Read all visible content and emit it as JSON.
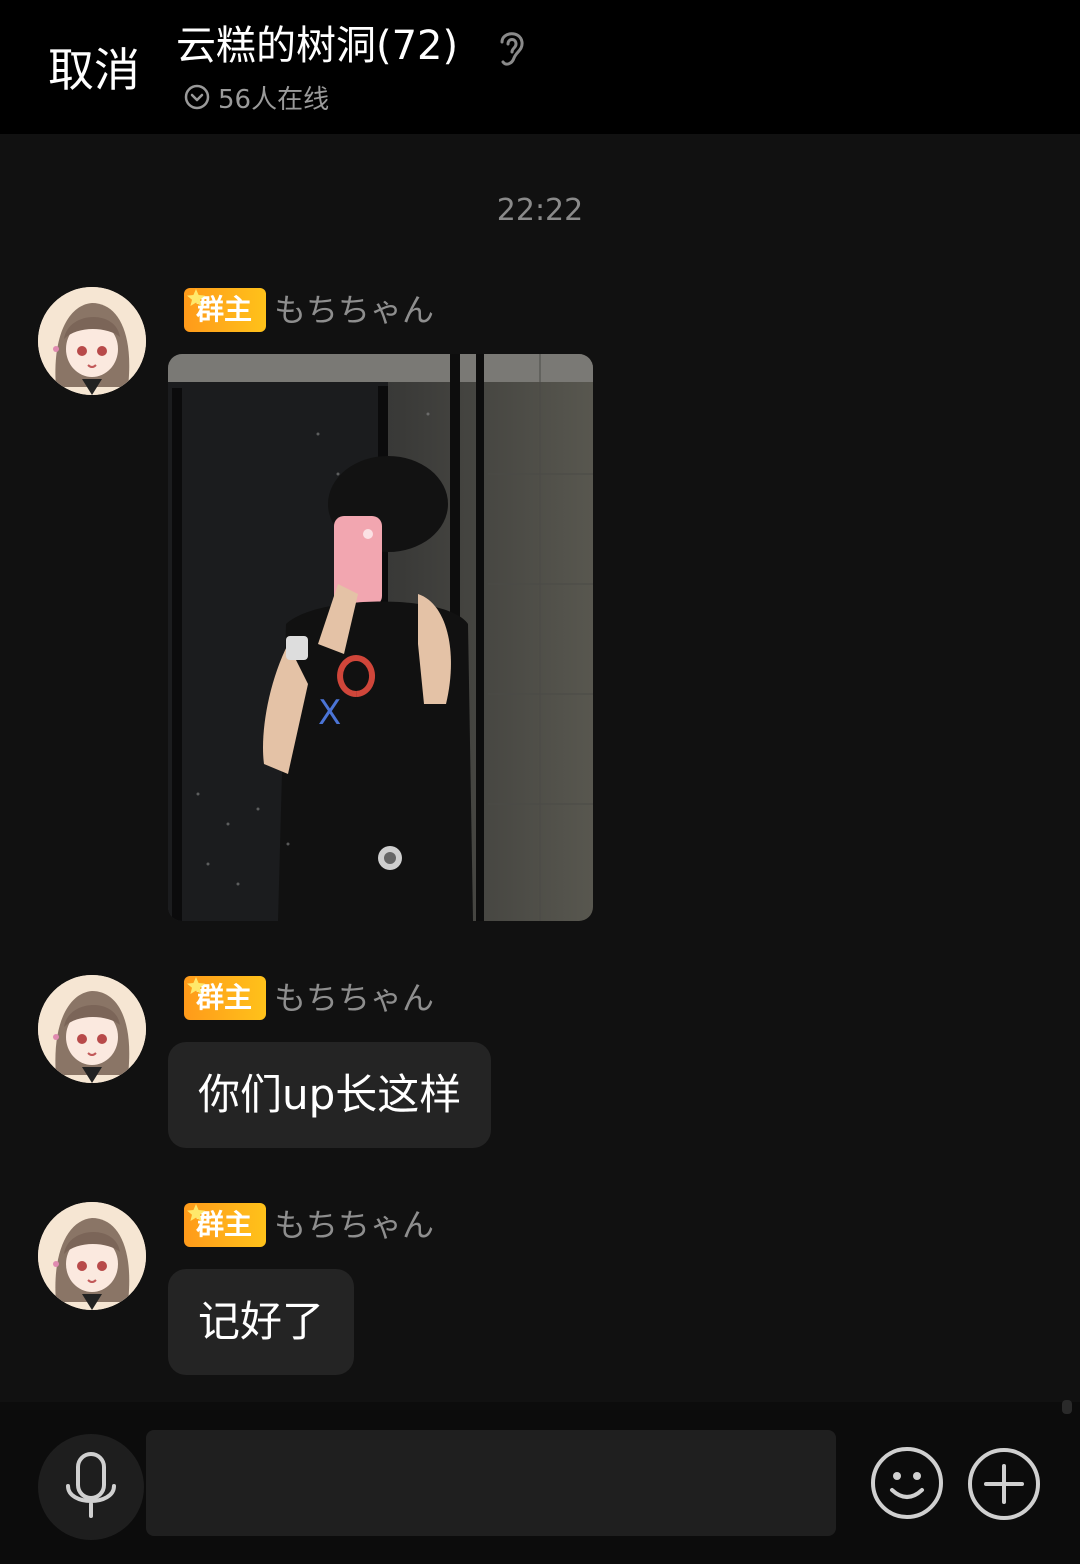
{
  "header": {
    "cancel_label": "取消",
    "title": "云糕的树洞(72)",
    "online": "56人在线"
  },
  "chat": {
    "timestamp": "22:22",
    "messages": [
      {
        "badge": "群主",
        "sender": "もちちゃん",
        "type": "image"
      },
      {
        "badge": "群主",
        "sender": "もちちゃん",
        "type": "text",
        "text": "你们up长这样"
      },
      {
        "badge": "群主",
        "sender": "もちちゃん",
        "type": "text",
        "text": "记好了"
      }
    ]
  },
  "input": {
    "placeholder": ""
  },
  "colors": {
    "background": "#111111",
    "header_bg": "#000000",
    "bubble_bg": "#242424",
    "badge_start": "#ff9a1a",
    "badge_end": "#ffc21a",
    "muted_text": "#8e8e8e"
  },
  "icons": [
    "ear-icon",
    "check-circle-icon",
    "star-icon",
    "microphone-icon",
    "smile-icon",
    "plus-circle-icon"
  ]
}
